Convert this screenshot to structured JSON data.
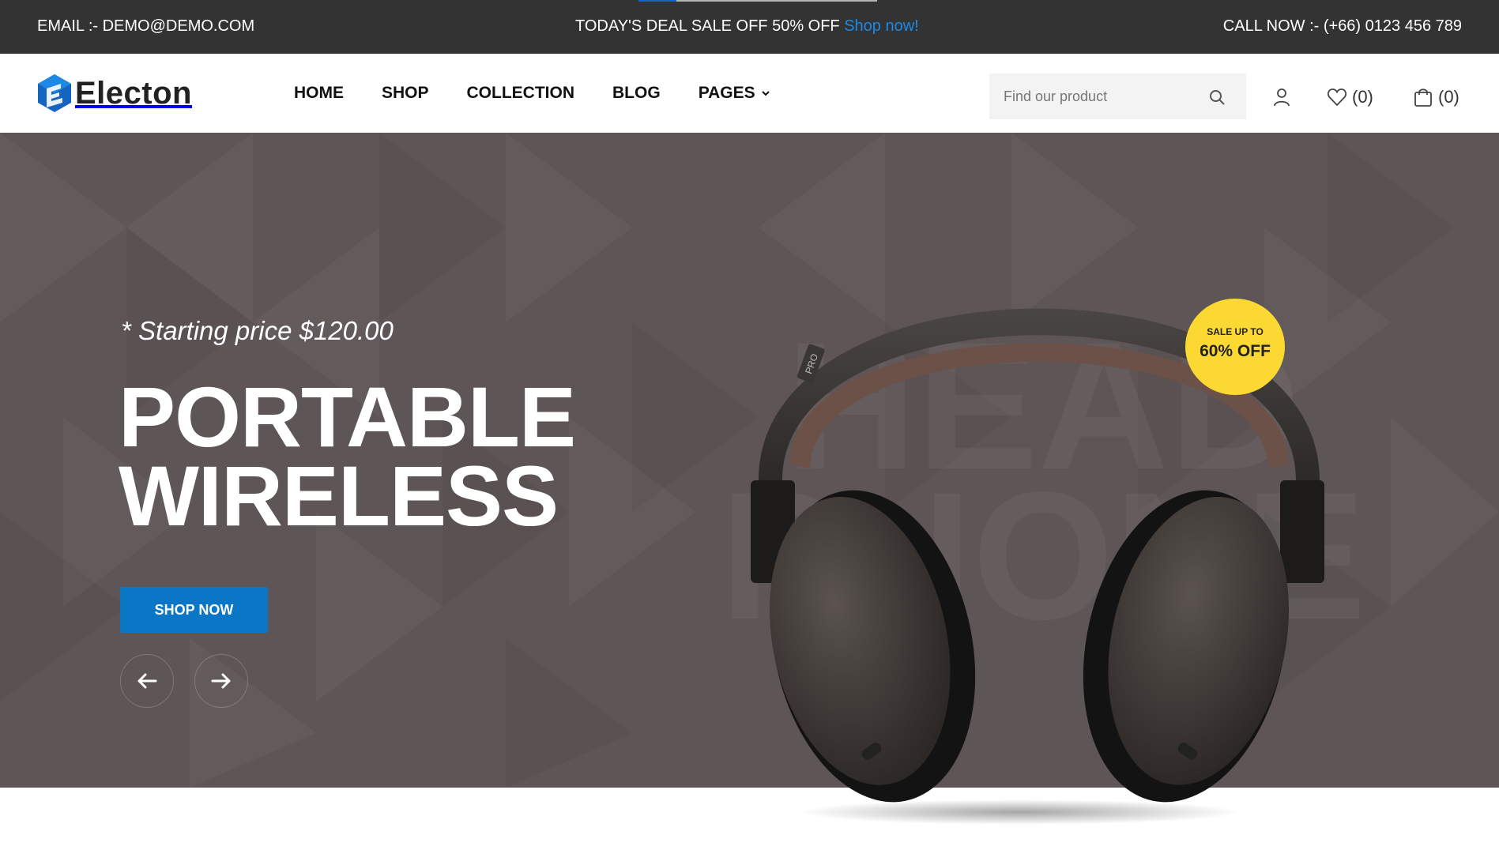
{
  "topbar": {
    "email": "EMAIL :- DEMO@DEMO.COM",
    "deal_text": "TODAY'S DEAL SALE OFF 50% OFF",
    "deal_link": "Shop now!",
    "call": "CALL NOW :- (+66) 0123 456 789",
    "progress": 0.16
  },
  "header": {
    "logo_text": "Electon",
    "nav": [
      {
        "label": "HOME"
      },
      {
        "label": "SHOP"
      },
      {
        "label": "COLLECTION"
      },
      {
        "label": "BLOG"
      },
      {
        "label": "PAGES",
        "has_dropdown": true
      }
    ],
    "search": {
      "placeholder": "Find our product"
    },
    "wishlist_count": "(0)",
    "cart_count": "(0)",
    "icons": [
      "search-icon",
      "user-icon",
      "heart-icon",
      "shopping-bag-icon"
    ]
  },
  "hero": {
    "subtitle": "* Starting price $120.00",
    "title_line1": "PORTABLE",
    "title_line2": "WIRELESS",
    "button_label": "SHOP NOW",
    "watermark_line1": "HEAD",
    "watermark_line2": "PHONE",
    "badge_small": "SALE UP TO",
    "badge_big": "60% OFF",
    "headphone_tag": "PRO",
    "background_color": "#5e5556",
    "accent_color": "#0b76c5",
    "badge_color": "#fbd932"
  }
}
